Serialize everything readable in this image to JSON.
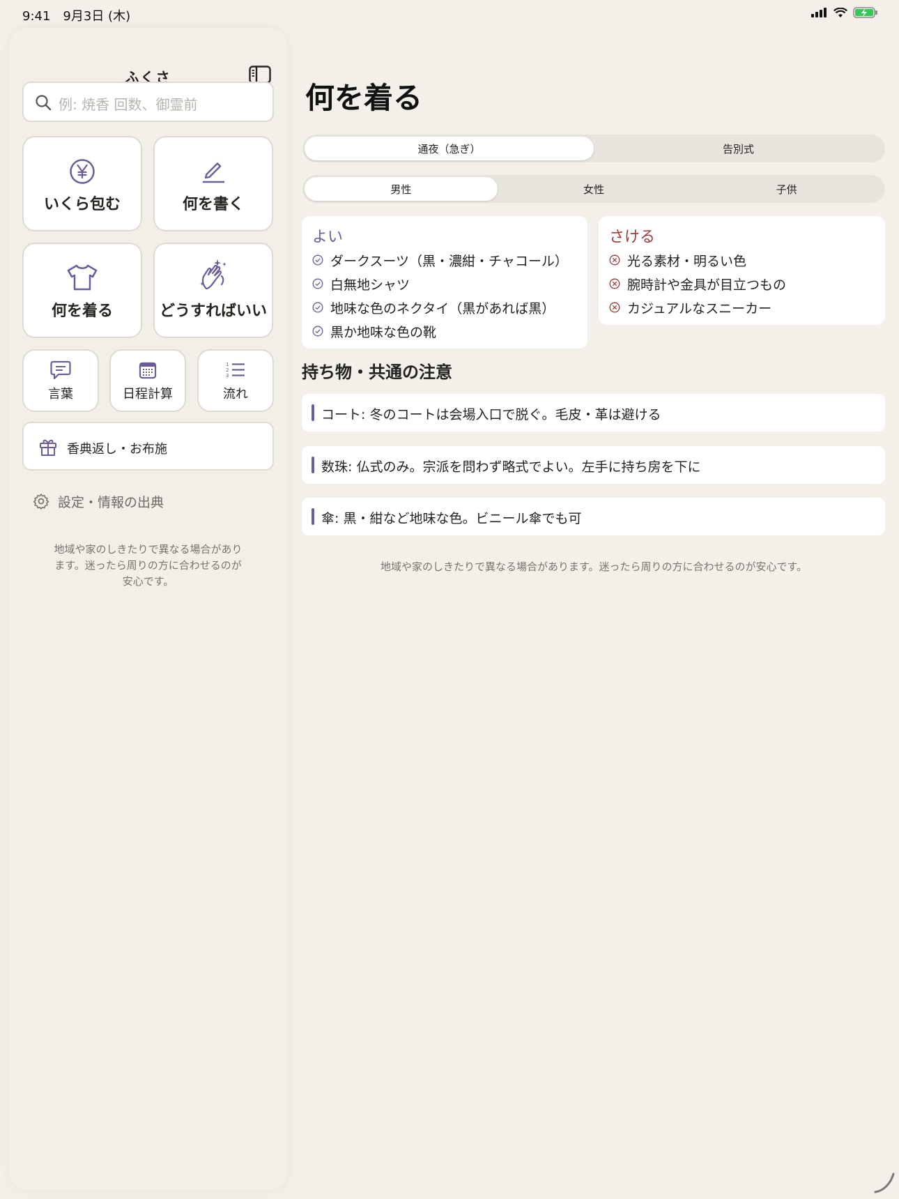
{
  "status_bar": {
    "time": "9:41　9月3日 (木)"
  },
  "sidebar": {
    "title": "ふくさ",
    "search_placeholder": "例: 焼香 回数、御霊前",
    "tiles_large": [
      {
        "label": "いくら包む",
        "icon": "yen-circle-icon"
      },
      {
        "label": "何を書く",
        "icon": "pen-icon"
      },
      {
        "label": "何を着る",
        "icon": "tshirt-icon"
      },
      {
        "label": "どうすればいい",
        "icon": "hands-clap-icon"
      }
    ],
    "tiles_small": [
      {
        "label": "言葉",
        "icon": "chat-bubble-icon"
      },
      {
        "label": "日程計算",
        "icon": "calendar-icon"
      },
      {
        "label": "流れ",
        "icon": "numbered-list-icon"
      }
    ],
    "wide_tile_label": "香典返し・お布施",
    "settings_label": "設定・情報の出典",
    "note": "地域や家のしきたりで異なる場合があります。迷ったら周りの方に合わせるのが安心です。"
  },
  "main": {
    "title": "何を着る",
    "event_segment": [
      "通夜（急ぎ）",
      "告別式"
    ],
    "event_selected": "通夜（急ぎ）",
    "person_segment": [
      "男性",
      "女性",
      "子供"
    ],
    "person_selected": "男性",
    "good": {
      "title": "よい",
      "items": [
        "ダークスーツ（黒・濃紺・チャコール）",
        "白無地シャツ",
        "地味な色のネクタイ（黒があれば黒）",
        "黒か地味な色の靴"
      ]
    },
    "avoid": {
      "title": "さける",
      "items": [
        "光る素材・明るい色",
        "腕時計や金具が目立つもの",
        "カジュアルなスニーカー"
      ]
    },
    "section_title": "持ち物・共通の注意",
    "notes": [
      "コート: 冬のコートは会場入口で脱ぐ。毛皮・革は避ける",
      "数珠: 仏式のみ。宗派を問わず略式でよい。左手に持ち房を下に",
      "傘: 黒・紺など地味な色。ビニール傘でも可"
    ],
    "footer": "地域や家のしきたりで異なる場合があります。迷ったら周りの方に合わせるのが安心です。"
  },
  "colors": {
    "accent": "#6b5c98",
    "avoid": "#9b3b3b",
    "background": "#f3f0ea",
    "card": "#ffffff"
  }
}
